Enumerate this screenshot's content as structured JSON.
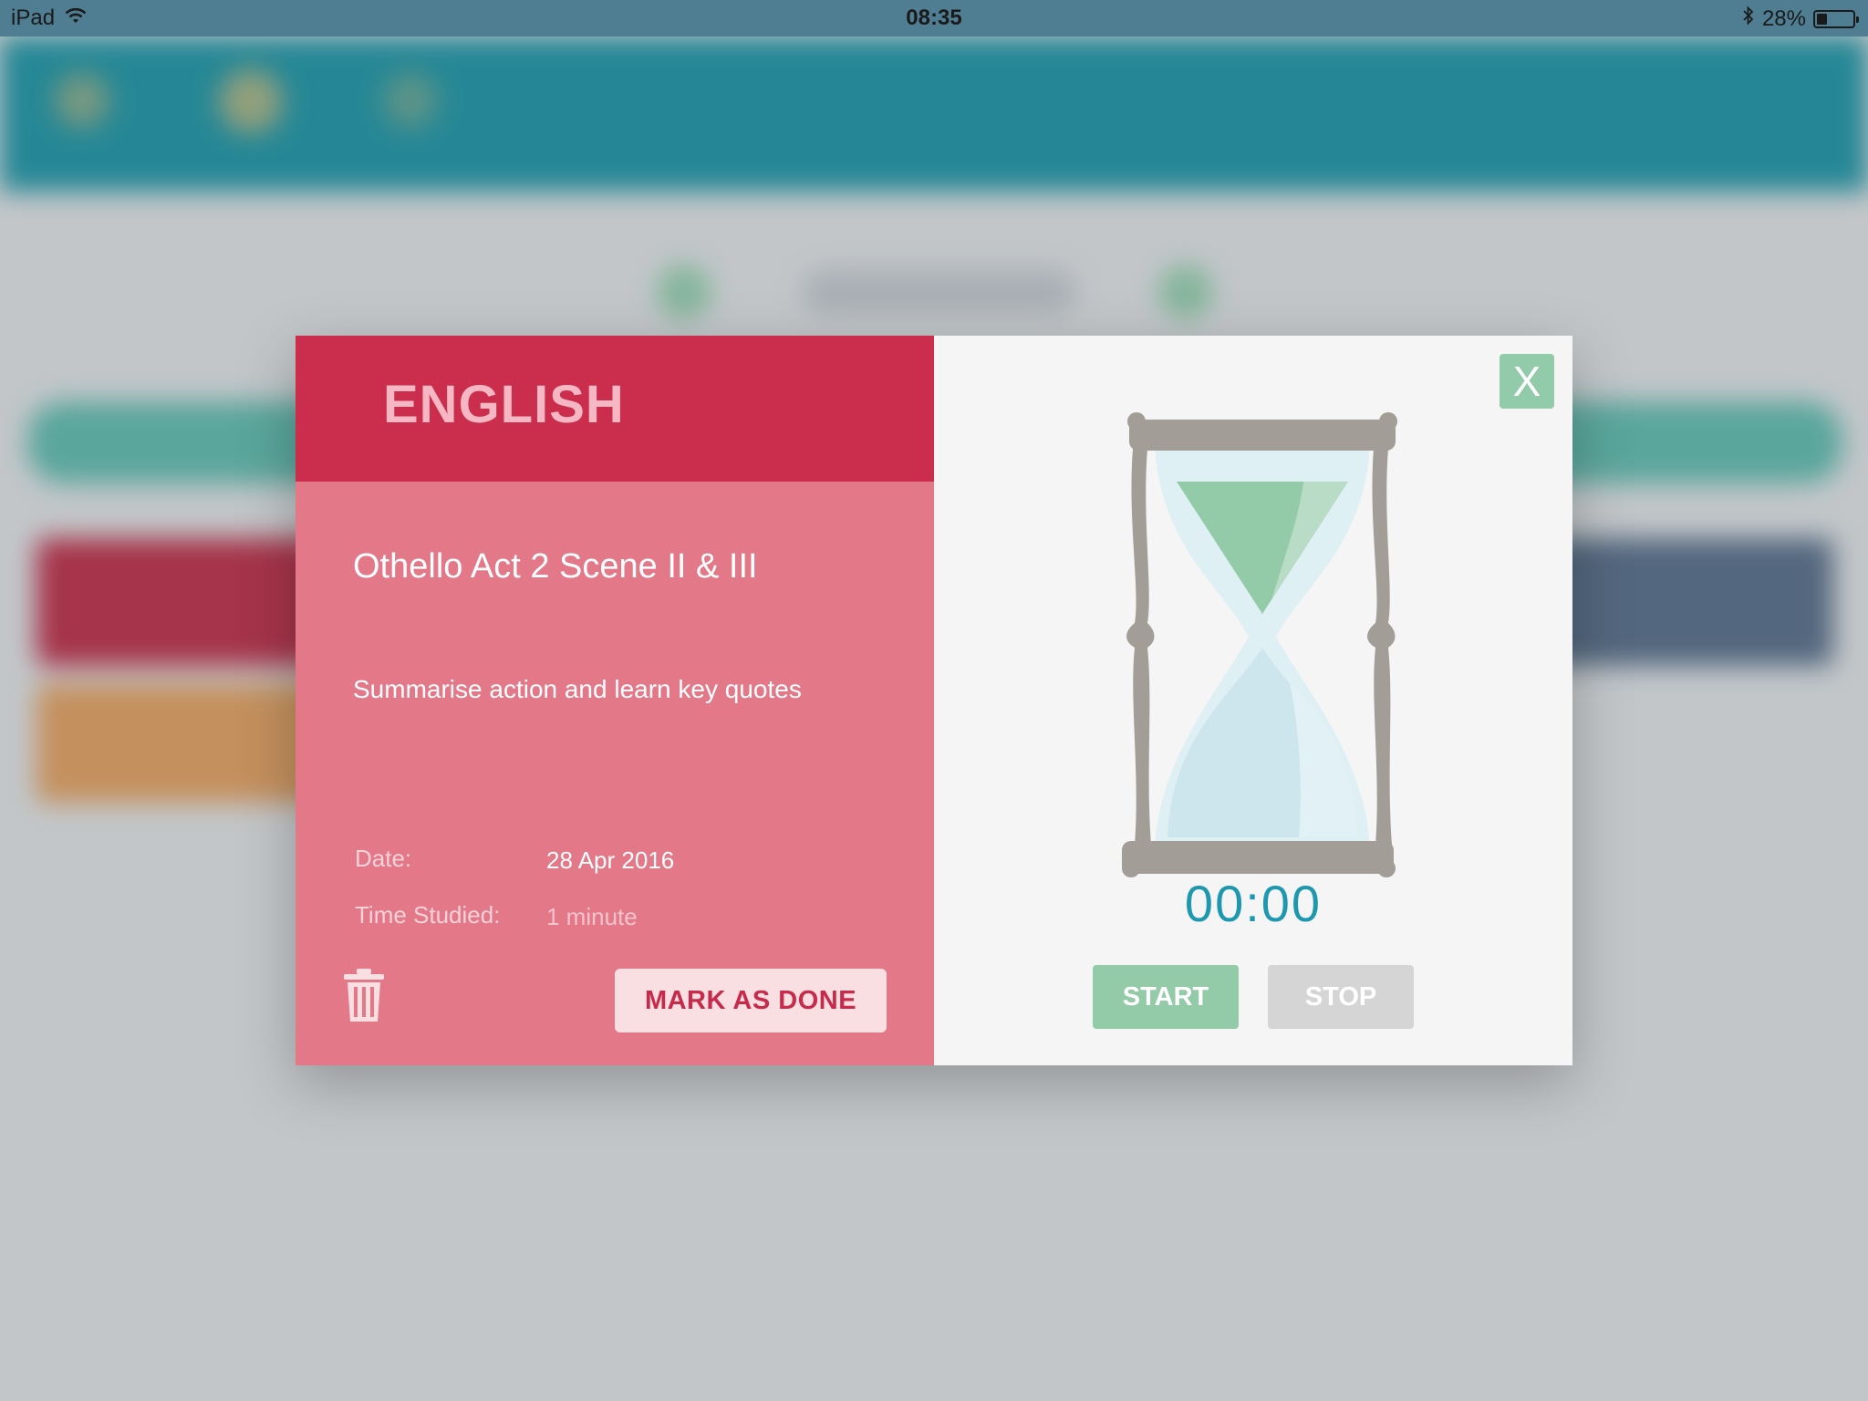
{
  "status_bar": {
    "device": "iPad",
    "time": "08:35",
    "battery": "28%",
    "battery_level": 0.28
  },
  "modal": {
    "subject": "ENGLISH",
    "task_title": "Othello Act 2 Scene II & III",
    "task_description": "Summarise action and learn key quotes",
    "date_label": "Date:",
    "date_value": "28 Apr 2016",
    "time_studied_label": "Time Studied:",
    "time_studied_value": "1 minute",
    "mark_done_label": "MARK AS DONE",
    "close_label": "X",
    "timer": "00:00",
    "start_label": "START",
    "stop_label": "STOP"
  },
  "colors": {
    "subject_header": "#cb2e4d",
    "subject_panel": "#e37889",
    "accent_green": "#93caa7",
    "timer_blue": "#1e98ae",
    "app_header": "#23909f"
  }
}
